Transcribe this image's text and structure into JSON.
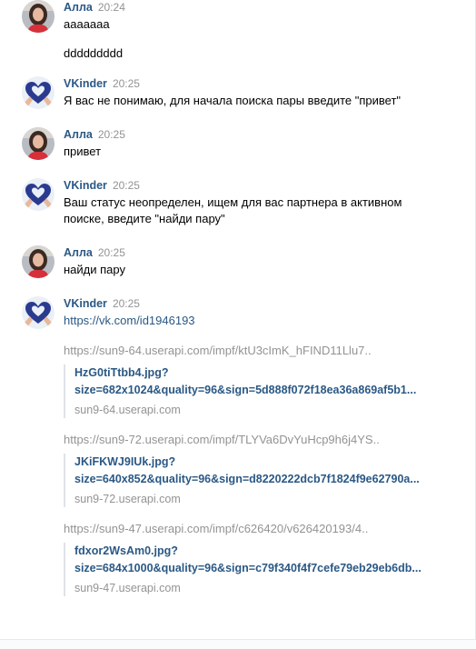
{
  "messages": [
    {
      "author": "Алла",
      "time": "20:24",
      "lines": [
        "ааааааа",
        "ddddddddd"
      ]
    },
    {
      "author": "VKinder",
      "time": "20:25",
      "lines": [
        "Я вас не понимаю, для начала поиска пары введите \"привет\""
      ]
    },
    {
      "author": "Алла",
      "time": "20:25",
      "lines": [
        "привет"
      ]
    },
    {
      "author": "VKinder",
      "time": "20:25",
      "lines": [
        "Ваш статус неопределен, ищем для вас партнера в активном",
        "поиске, введите \"найди пару\""
      ]
    },
    {
      "author": "Алла",
      "time": "20:25",
      "lines": [
        "найди пару"
      ]
    },
    {
      "author": "VKinder",
      "time": "20:25",
      "profile_link": "https://vk.com/id1946193",
      "attachments": [
        {
          "url": "https://sun9-64.userapi.com/impf/ktU3cImK_hFIND11Llu7..",
          "title_line1": "HzG0tiTtbb4.jpg?",
          "title_line2": "size=682x1024&quality=96&sign=5d888f072f18ea36a869af5b1...",
          "domain": "sun9-64.userapi.com"
        },
        {
          "url": "https://sun9-72.userapi.com/impf/TLYVa6DvYuHcp9h6j4YS..",
          "title_line1": "JKiFKWJ9IUk.jpg?",
          "title_line2": "size=640x852&quality=96&sign=d8220222dcb7f1824f9e62790a...",
          "domain": "sun9-72.userapi.com"
        },
        {
          "url": "https://sun9-47.userapi.com/impf/c626420/v626420193/4..",
          "title_line1": "fdxor2WsAm0.jpg?",
          "title_line2": "size=684x1000&quality=96&sign=c79f340f4f7cefe79eb29eb6db...",
          "domain": "sun9-47.userapi.com"
        }
      ]
    }
  ],
  "colors": {
    "author": "#2a5885",
    "time": "#939393",
    "link": "#2a5885",
    "heart": "#2a3b8f",
    "avatar_bg": "#eaf0f6"
  },
  "icons": {
    "user_avatar": "woman-photo-avatar",
    "bot_avatar": "heart-hands-avatar"
  }
}
